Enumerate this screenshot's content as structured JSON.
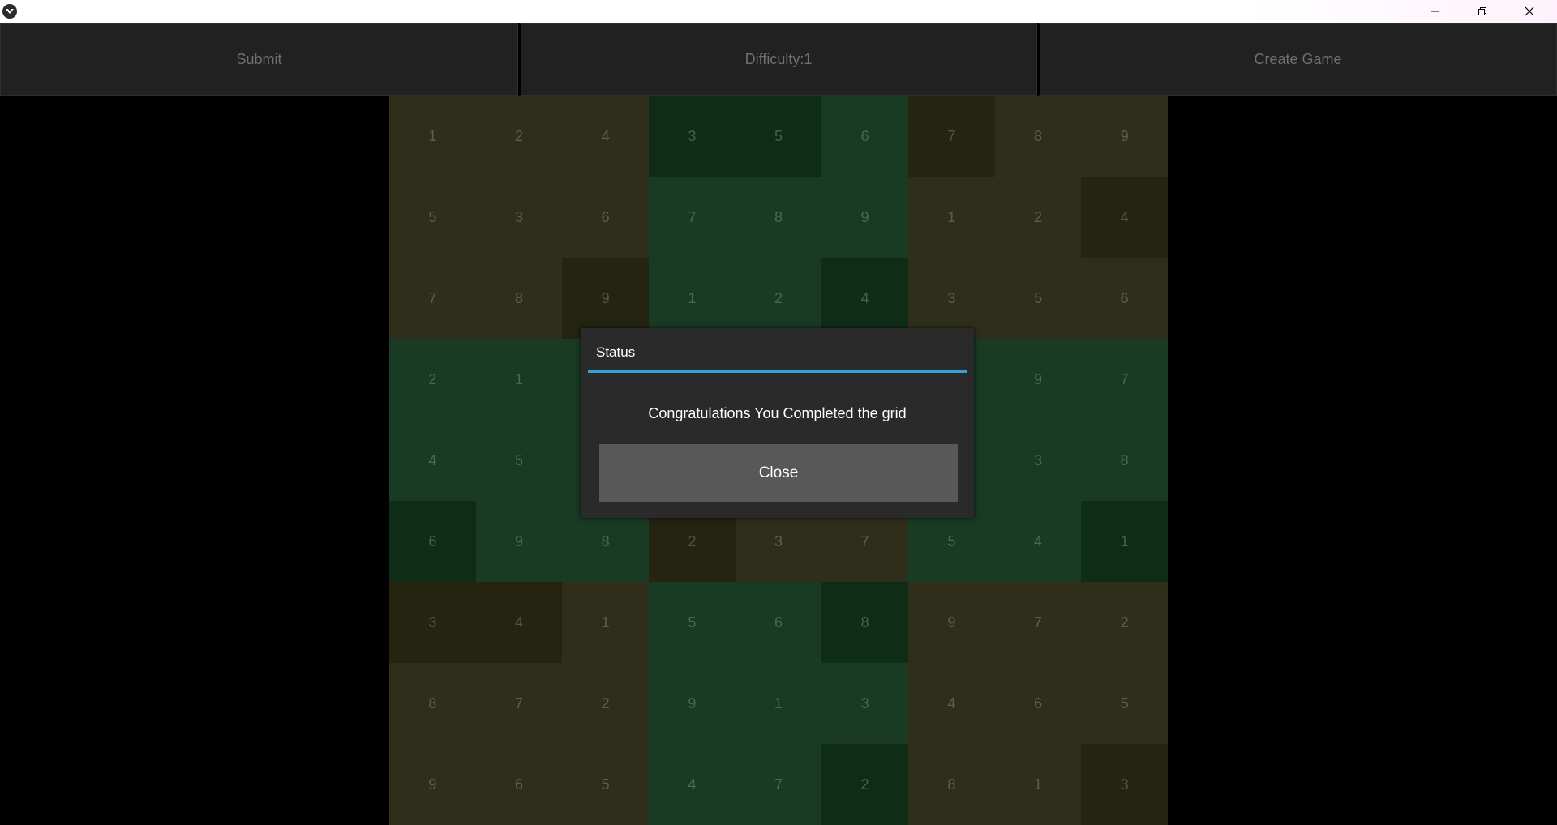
{
  "window": {
    "controls": [
      "minimize-icon",
      "restore-icon",
      "close-icon"
    ]
  },
  "toolbar": {
    "submit_label": "Submit",
    "difficulty_label": "Difficulty:1",
    "create_game_label": "Create Game"
  },
  "grid": {
    "rows": [
      [
        1,
        2,
        4,
        3,
        5,
        6,
        7,
        8,
        9
      ],
      [
        5,
        3,
        6,
        7,
        8,
        9,
        1,
        2,
        4
      ],
      [
        7,
        8,
        9,
        1,
        2,
        4,
        3,
        5,
        6
      ],
      [
        2,
        1,
        "",
        "",
        "",
        "",
        "",
        9,
        7
      ],
      [
        4,
        5,
        "",
        "",
        "",
        "",
        "",
        3,
        8
      ],
      [
        6,
        9,
        8,
        2,
        3,
        7,
        5,
        4,
        1
      ],
      [
        3,
        4,
        1,
        5,
        6,
        8,
        9,
        7,
        2
      ],
      [
        8,
        7,
        2,
        9,
        1,
        3,
        4,
        6,
        5
      ],
      [
        9,
        6,
        5,
        4,
        7,
        2,
        8,
        1,
        3
      ]
    ],
    "shades": [
      [
        "olive",
        "olive",
        "olive",
        "green-dark",
        "green-dark",
        "green",
        "olive-dark",
        "olive",
        "olive"
      ],
      [
        "olive",
        "olive",
        "olive",
        "green",
        "green",
        "green",
        "olive",
        "olive",
        "olive-dark"
      ],
      [
        "olive",
        "olive",
        "olive-dark",
        "green",
        "green",
        "green-dark",
        "olive",
        "olive",
        "olive"
      ],
      [
        "green",
        "green",
        "green",
        "olive",
        "olive",
        "olive",
        "green",
        "green",
        "green"
      ],
      [
        "green",
        "green",
        "green",
        "olive",
        "olive",
        "olive",
        "green",
        "green",
        "green"
      ],
      [
        "green-dark",
        "green",
        "green",
        "olive-dark",
        "olive",
        "olive",
        "green",
        "green",
        "green-dark"
      ],
      [
        "olive-dark",
        "olive-dark",
        "olive",
        "green",
        "green",
        "green-dark",
        "olive",
        "olive",
        "olive"
      ],
      [
        "olive",
        "olive",
        "olive",
        "green",
        "green",
        "green",
        "olive",
        "olive",
        "olive"
      ],
      [
        "olive",
        "olive",
        "olive",
        "green",
        "green",
        "green-dark",
        "olive",
        "olive",
        "olive-dark"
      ]
    ]
  },
  "dialog": {
    "title": "Status",
    "message": "Congratulations You Completed the grid",
    "close_label": "Close",
    "accent_color": "#33a0d6"
  }
}
